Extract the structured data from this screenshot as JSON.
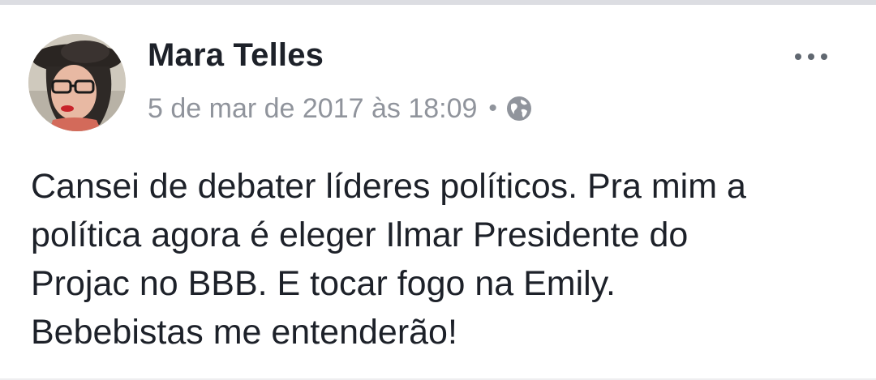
{
  "post": {
    "author": "Mara Telles",
    "timestamp": "5 de mar de 2017 às 18:09",
    "separator": "•",
    "privacy_icon": "globe-icon",
    "more_icon": "ellipsis-icon",
    "text_lines": [
      "Cansei de debater líderes políticos. Pra mim a",
      "política agora é eleger Ilmar Presidente do",
      "Projac no BBB. E tocar fogo na Emily.",
      "Bebebistas me entenderão!"
    ]
  },
  "colors": {
    "name": "#1d2129",
    "meta": "#90949c",
    "body_text": "#1d2129",
    "divider": "#dcdde2"
  }
}
